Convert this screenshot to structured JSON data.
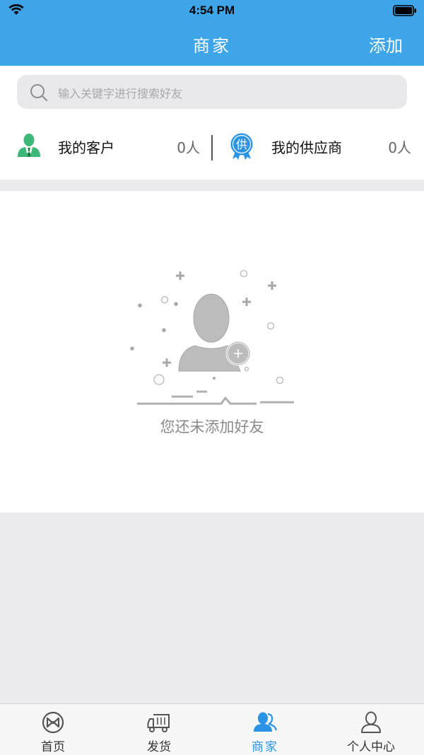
{
  "status_bar": {
    "time": "4:54 PM"
  },
  "nav": {
    "title": "商家",
    "add_label": "添加"
  },
  "search": {
    "placeholder": "输入关键字进行搜索好友"
  },
  "stats": [
    {
      "label": "我的客户",
      "count": "0人",
      "icon": "customer-person-icon"
    },
    {
      "label": "我的供应商",
      "count": "0人",
      "badge": "供",
      "icon": "supplier-badge-icon"
    }
  ],
  "empty": {
    "message": "您还未添加好友"
  },
  "tabs": [
    {
      "label": "首页",
      "icon": "home-logo-icon",
      "active": false
    },
    {
      "label": "发货",
      "icon": "truck-icon",
      "active": false
    },
    {
      "label": "商家",
      "icon": "contacts-icon",
      "active": true
    },
    {
      "label": "个人中心",
      "icon": "user-profile-icon",
      "active": false
    }
  ],
  "colors": {
    "header": "#3ea5e8",
    "active_tab": "#2b94e6",
    "customer_icon": "#3cb878",
    "supplier_icon": "#2b94e6",
    "page_bg": "#ececee"
  }
}
